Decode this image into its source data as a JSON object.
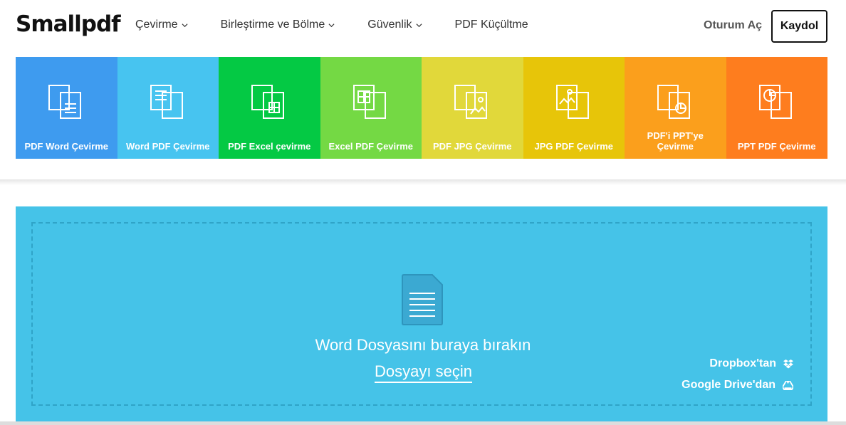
{
  "header": {
    "logo": "Smallpdf",
    "nav": [
      {
        "label": "Çevirme",
        "dropdown": true
      },
      {
        "label": "Birleştirme ve Bölme",
        "dropdown": true
      },
      {
        "label": "Güvenlik",
        "dropdown": true
      },
      {
        "label": "PDF Küçültme",
        "dropdown": false
      }
    ],
    "login": "Oturum Aç",
    "signup": "Kaydol"
  },
  "tools": [
    {
      "label": "PDF Word Çevirme",
      "color": "#3e9bef",
      "icon": "pdf-to-word-icon"
    },
    {
      "label": "Word PDF Çevirme",
      "color": "#47c4f0",
      "icon": "word-to-pdf-icon"
    },
    {
      "label": "PDF Excel çevirme",
      "color": "#04c944",
      "icon": "pdf-to-excel-icon"
    },
    {
      "label": "Excel PDF Çevirme",
      "color": "#74d944",
      "icon": "excel-to-pdf-icon"
    },
    {
      "label": "PDF JPG Çevirme",
      "color": "#e1d83a",
      "icon": "pdf-to-jpg-icon"
    },
    {
      "label": "JPG PDF Çevirme",
      "color": "#e7c509",
      "icon": "jpg-to-pdf-icon"
    },
    {
      "label": "PDF'i PPT'ye Çevirme",
      "color": "#fb9f1c",
      "icon": "pdf-to-ppt-icon"
    },
    {
      "label": "PPT PDF Çevirme",
      "color": "#fe7d1e",
      "icon": "ppt-to-pdf-icon"
    }
  ],
  "dropzone": {
    "title": "Word Dosyasını buraya bırakın",
    "choose": "Dosyayı seçin",
    "dropbox": "Dropbox'tan",
    "gdrive": "Google Drive'dan",
    "bg_color": "#45c3e8"
  }
}
